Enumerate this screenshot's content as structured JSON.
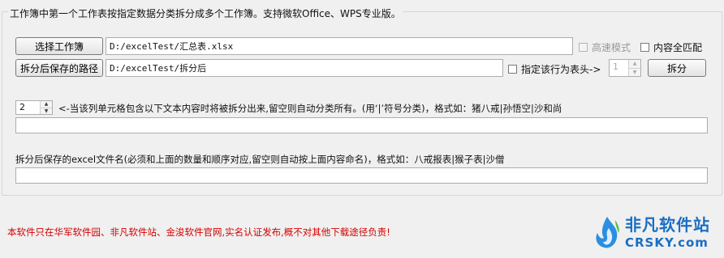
{
  "group": {
    "legend": "工作簿中第一个工作表按指定数据分类拆分成多个工作簿。支持微软Office、WPS专业版。"
  },
  "row1": {
    "select_button": "选择工作簿",
    "path_value": "D:/excelTest/汇总表.xlsx",
    "fast_mode_label": "高速模式",
    "full_match_label": "内容全匹配"
  },
  "row2": {
    "save_path_button": "拆分后保存的路径",
    "save_path_value": "D:/excelTest/拆分后",
    "header_row_label": "指定该行为表头->",
    "header_row_value": "1",
    "split_button": "拆分"
  },
  "column_section": {
    "column_value": "2",
    "instruction": "<-当该列单元格包含以下文本内容时将被拆分出来,留空则自动分类所有。(用‘|’符号分类)，格式如：猪八戒|孙悟空|沙和尚",
    "filter_value": ""
  },
  "filename_section": {
    "instruction": "拆分后保存的excel文件名(必须和上面的数量和顺序对应,留空则自动按上面内容命名)，格式如：八戒报表|猴子表|沙僧",
    "filename_value": ""
  },
  "footer": {
    "notice": "本软件只在华军软件园、非凡软件站、金浚软件官网,实名认证发布,概不对其他下载途径负责!",
    "logo_cn": "非凡软件站",
    "logo_en": "CRSKY.com"
  }
}
